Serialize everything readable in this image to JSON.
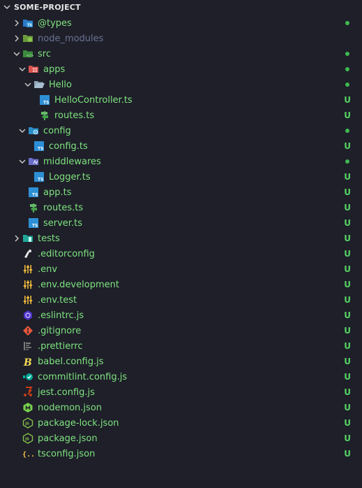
{
  "header": {
    "title": "SOME-PROJECT"
  },
  "tree": [
    {
      "label": "@types",
      "name": "folder-types",
      "icon": "types-folder-icon",
      "depth": 1,
      "chev": "right",
      "marker": "dot"
    },
    {
      "label": "node_modules",
      "name": "folder-node-modules",
      "icon": "node-folder-icon",
      "depth": 1,
      "chev": "right",
      "marker": "none",
      "faded": true
    },
    {
      "label": "src",
      "name": "folder-src",
      "icon": "src-folder-icon",
      "depth": 1,
      "chev": "down",
      "marker": "dot"
    },
    {
      "label": "apps",
      "name": "folder-apps",
      "icon": "apps-folder-icon",
      "depth": 2,
      "chev": "down",
      "marker": "dot"
    },
    {
      "label": "Hello",
      "name": "folder-hello",
      "icon": "open-folder-icon",
      "depth": 3,
      "chev": "down",
      "marker": "dot"
    },
    {
      "label": "HelloController.ts",
      "name": "file-hello-controller",
      "icon": "typescript-icon",
      "depth": 4,
      "chev": "none",
      "marker": "U"
    },
    {
      "label": "routes.ts",
      "name": "file-hello-routes",
      "icon": "routes-icon",
      "depth": 4,
      "chev": "none",
      "marker": "U"
    },
    {
      "label": "config",
      "name": "folder-config",
      "icon": "config-folder-icon",
      "depth": 2,
      "chev": "down",
      "marker": "dot"
    },
    {
      "label": "config.ts",
      "name": "file-config",
      "icon": "typescript-icon",
      "depth": 3,
      "chev": "none",
      "marker": "U"
    },
    {
      "label": "middlewares",
      "name": "folder-middlewares",
      "icon": "middleware-folder-icon",
      "depth": 2,
      "chev": "down",
      "marker": "dot"
    },
    {
      "label": "Logger.ts",
      "name": "file-logger",
      "icon": "typescript-icon",
      "depth": 3,
      "chev": "none",
      "marker": "U"
    },
    {
      "label": "app.ts",
      "name": "file-app",
      "icon": "typescript-icon",
      "depth": 2,
      "chev": "none",
      "marker": "U"
    },
    {
      "label": "routes.ts",
      "name": "file-routes",
      "icon": "routes-icon",
      "depth": 2,
      "chev": "none",
      "marker": "U"
    },
    {
      "label": "server.ts",
      "name": "file-server",
      "icon": "typescript-icon",
      "depth": 2,
      "chev": "none",
      "marker": "U"
    },
    {
      "label": "tests",
      "name": "folder-tests",
      "icon": "test-folder-icon",
      "depth": 1,
      "chev": "right",
      "marker": "U"
    },
    {
      "label": ".editorconfig",
      "name": "file-editorconfig",
      "icon": "editorconfig-icon",
      "depth": 1,
      "chev": "none",
      "marker": "U"
    },
    {
      "label": ".env",
      "name": "file-env",
      "icon": "env-icon",
      "depth": 1,
      "chev": "none",
      "marker": "U"
    },
    {
      "label": ".env.development",
      "name": "file-env-development",
      "icon": "env-icon",
      "depth": 1,
      "chev": "none",
      "marker": "U"
    },
    {
      "label": ".env.test",
      "name": "file-env-test",
      "icon": "env-icon",
      "depth": 1,
      "chev": "none",
      "marker": "U"
    },
    {
      "label": ".eslintrc.js",
      "name": "file-eslintrc",
      "icon": "eslint-icon",
      "depth": 1,
      "chev": "none",
      "marker": "U"
    },
    {
      "label": ".gitignore",
      "name": "file-gitignore",
      "icon": "git-icon",
      "depth": 1,
      "chev": "none",
      "marker": "U"
    },
    {
      "label": ".prettierrc",
      "name": "file-prettierrc",
      "icon": "prettier-icon",
      "depth": 1,
      "chev": "none",
      "marker": "U"
    },
    {
      "label": "babel.config.js",
      "name": "file-babel-config",
      "icon": "babel-icon",
      "depth": 1,
      "chev": "none",
      "marker": "U"
    },
    {
      "label": "commitlint.config.js",
      "name": "file-commitlint-config",
      "icon": "commitlint-icon",
      "depth": 1,
      "chev": "none",
      "marker": "U"
    },
    {
      "label": "jest.config.js",
      "name": "file-jest-config",
      "icon": "jest-icon",
      "depth": 1,
      "chev": "none",
      "marker": "U"
    },
    {
      "label": "nodemon.json",
      "name": "file-nodemon",
      "icon": "nodemon-icon",
      "depth": 1,
      "chev": "none",
      "marker": "U"
    },
    {
      "label": "package-lock.json",
      "name": "file-package-lock",
      "icon": "nodejs-icon",
      "depth": 1,
      "chev": "none",
      "marker": "U"
    },
    {
      "label": "package.json",
      "name": "file-package",
      "icon": "nodejs-icon",
      "depth": 1,
      "chev": "none",
      "marker": "U"
    },
    {
      "label": "tsconfig.json",
      "name": "file-tsconfig",
      "icon": "json-icon",
      "depth": 1,
      "chev": "none",
      "marker": "U"
    }
  ]
}
